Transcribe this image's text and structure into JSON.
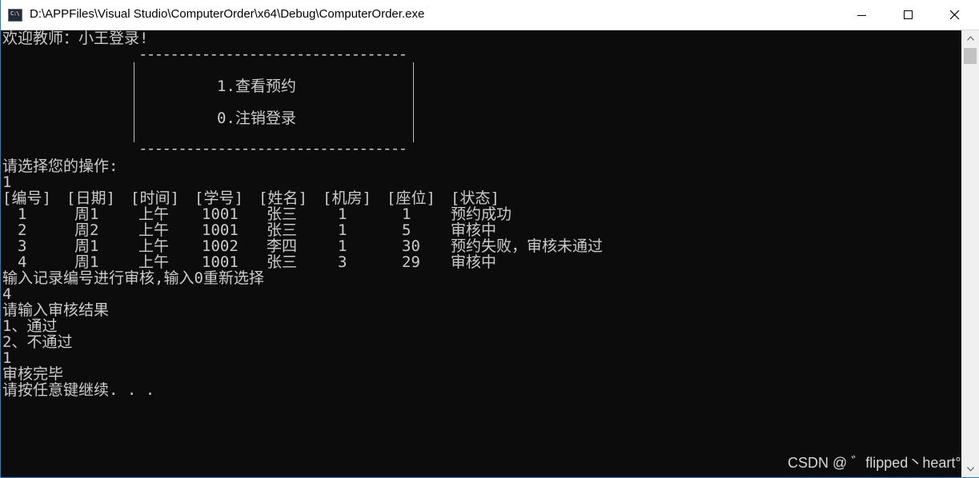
{
  "window": {
    "title": "D:\\APPFiles\\Visual Studio\\ComputerOrder\\x64\\Debug\\ComputerOrder.exe",
    "icon_label": "C:\\",
    "icon_name": "console-app-icon"
  },
  "console": {
    "welcome": "欢迎教师：小王登录!",
    "menu_rule": "----------------------------------",
    "menu_items": [
      "1.查看预约",
      "0.注销登录"
    ],
    "prompt_select": "请选择您的操作:",
    "input_1": "1",
    "table": {
      "headers": [
        "[编号]",
        "[日期]",
        "[时间]",
        "[学号]",
        "[姓名]",
        "[机房]",
        "[座位]",
        "[状态]"
      ],
      "rows": [
        [
          "1",
          "周1",
          "上午",
          "1001",
          "张三",
          "1",
          "1",
          "预约成功"
        ],
        [
          "2",
          "周2",
          "上午",
          "1001",
          "张三",
          "1",
          "5",
          "审核中"
        ],
        [
          "3",
          "周1",
          "上午",
          "1002",
          "李四",
          "1",
          "30",
          "预约失败，审核未通过"
        ],
        [
          "4",
          "周1",
          "上午",
          "1001",
          "张三",
          "3",
          "29",
          "审核中"
        ]
      ]
    },
    "prompt_record": "输入记录编号进行审核,输入0重新选择",
    "input_2": "4",
    "prompt_result": "请输入审核结果",
    "option_pass": "1、通过",
    "option_fail": "2、不通过",
    "input_3": "1",
    "done": "审核完毕",
    "press_key": "请按任意键继续. . ."
  },
  "watermark": "CSDN @ ゛flipped丶heart°",
  "colors": {
    "background": "#0c0c0c",
    "text": "#cccccc",
    "titlebar": "#ffffff",
    "border": "#1883d7"
  }
}
